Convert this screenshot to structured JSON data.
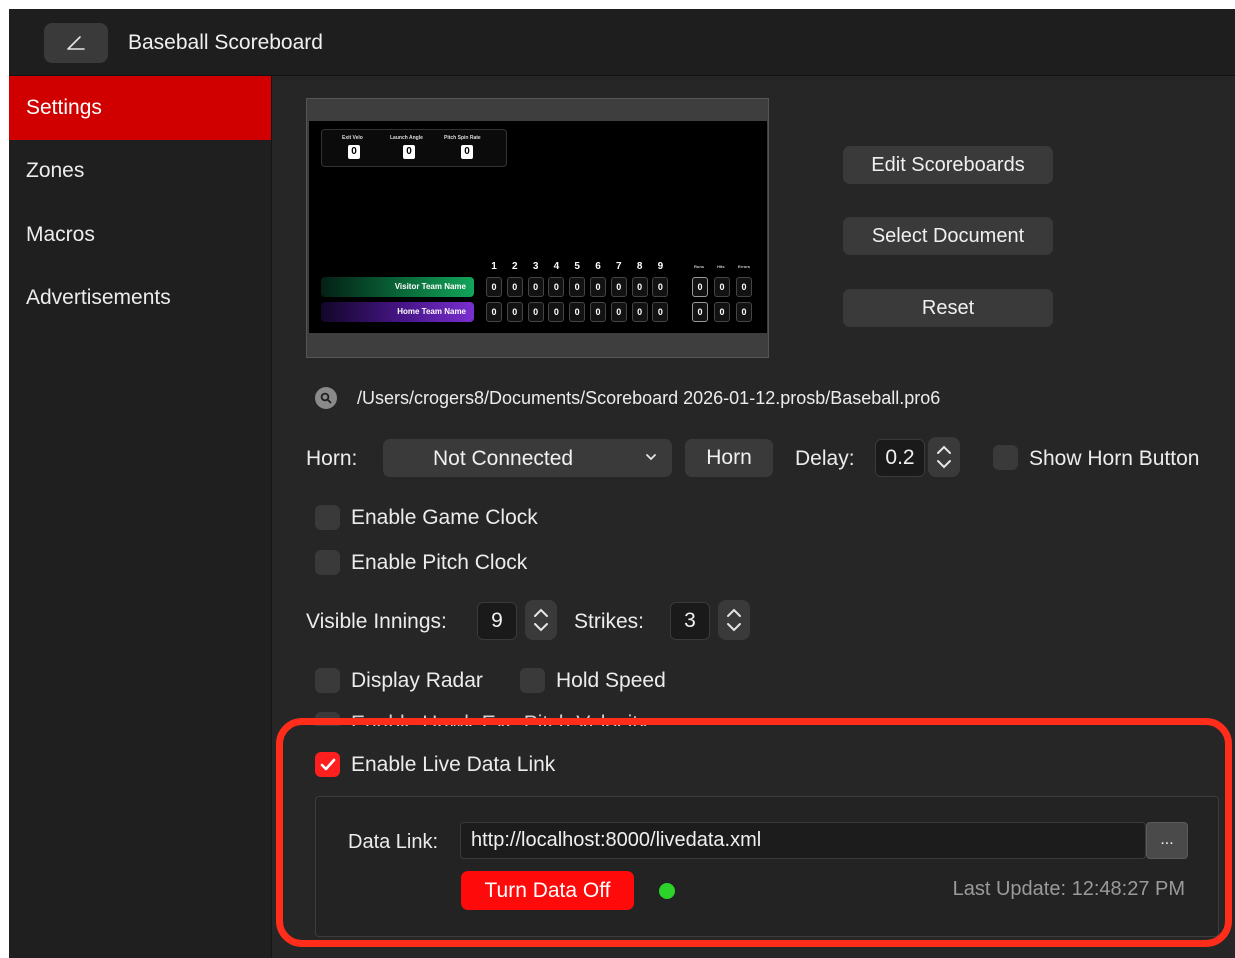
{
  "window": {
    "title": "Baseball Scoreboard"
  },
  "sidebar": {
    "items": [
      {
        "label": "Settings",
        "active": true
      },
      {
        "label": "Zones",
        "active": false
      },
      {
        "label": "Macros",
        "active": false
      },
      {
        "label": "Advertisements",
        "active": false
      }
    ]
  },
  "preview": {
    "radar": [
      {
        "label": "Exit Velo",
        "value": "0"
      },
      {
        "label": "Launch Angle",
        "value": "0"
      },
      {
        "label": "Pitch Spin Rate",
        "value": "0"
      }
    ],
    "innings": [
      "1",
      "2",
      "3",
      "4",
      "5",
      "6",
      "7",
      "8",
      "9"
    ],
    "totals_headers": [
      "Runs",
      "Hits",
      "Errors"
    ],
    "visitor_team": "Visitor Team Name",
    "home_team": "Home Team Name",
    "cell_value": "0"
  },
  "buttons": {
    "edit_scoreboards": "Edit Scoreboards",
    "select_document": "Select Document",
    "reset": "Reset"
  },
  "document_path": "/Users/crogers8/Documents/Scoreboard 2026-01-12.prosb/Baseball.pro6",
  "horn": {
    "label": "Horn:",
    "selected": "Not Connected",
    "button": "Horn",
    "delay_label": "Delay:",
    "delay_value": "0.2",
    "show_button_label": "Show Horn Button"
  },
  "options": {
    "game_clock": "Enable Game Clock",
    "pitch_clock": "Enable Pitch Clock",
    "visible_innings_label": "Visible Innings:",
    "visible_innings_value": "9",
    "strikes_label": "Strikes:",
    "strikes_value": "3",
    "display_radar": "Display Radar",
    "hold_speed": "Hold Speed",
    "hawkeye": "Enable Hawk-Eye Pitch Velocity"
  },
  "live_data": {
    "enable_label": "Enable Live Data Link",
    "enabled": true,
    "link_label": "Data Link:",
    "link_value": "http://localhost:8000/livedata.xml",
    "browse_label": "...",
    "toggle_button": "Turn Data Off",
    "status_color": "#2bd32b",
    "last_update": "Last Update: 12:48:27 PM"
  },
  "colors": {
    "accent": "#d10000",
    "highlight": "#ff2d1a"
  }
}
